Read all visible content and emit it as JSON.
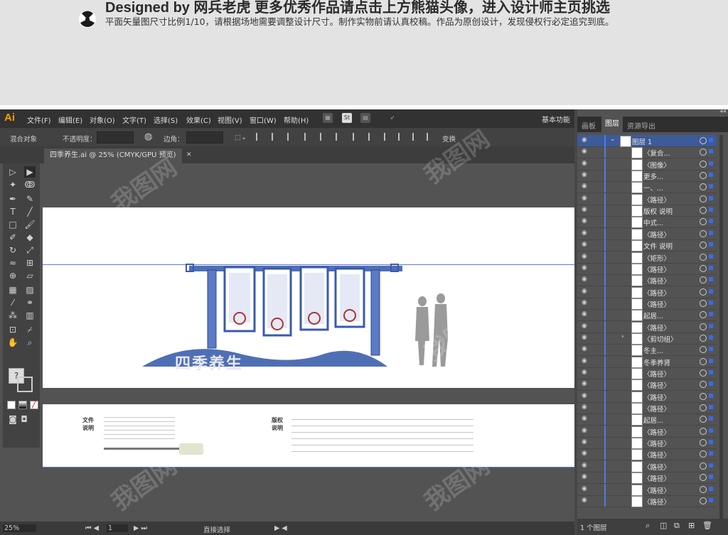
{
  "banner": {
    "title": "Designed by 网兵老虎        更多优秀作品请点击上方熊猫头像，进入设计师主页挑选",
    "subtitle": "平面矢量图尺寸比例1/10，请根据场地需要调整设计尺寸。制作实物前请认真校稿。作品为原创设计，发现侵权行必定追究到底。"
  },
  "app": {
    "logo": "Ai",
    "menu": [
      "文件(F)",
      "编辑(E)",
      "对象(O)",
      "文字(T)",
      "选择(S)",
      "效果(C)",
      "视图(V)",
      "窗口(W)",
      "帮助(H)"
    ],
    "workspace": "基本功能"
  },
  "control_bar": {
    "mode": "混合对象",
    "opacity_label": "不透明度：",
    "corner_label": "边角：",
    "transform_label": "变换"
  },
  "document_tab": {
    "title": "四季养生.ai @ 25% (CMYK/GPU 预览)"
  },
  "artwork": {
    "board_label_left": "文件\n说明",
    "board_label_right": "版权\n说明",
    "banner_text": "四季养生"
  },
  "status_bar": {
    "zoom": "25%",
    "page": "1",
    "tool": "直接选择"
  },
  "panel": {
    "tabs": [
      "画板",
      "图层",
      "资源导出"
    ],
    "active_tab": "图层",
    "layer_top": "图层 1",
    "rows": [
      "〈复合...",
      "〈图像〉",
      "更多...",
      "一、...",
      "〈路径〉",
      "版权 说明",
      "中式...",
      "〈路径〉",
      "文件 说明",
      "〈矩形〉",
      "〈路径〉",
      "〈路径〉",
      "〈路径〉",
      "〈路径〉",
      "起居...",
      "〈路径〉",
      "〈剪切组〉",
      "冬主...",
      "冬季养肾",
      "〈路径〉",
      "〈路径〉",
      "〈路径〉",
      "〈路径〉",
      "起居...",
      "〈路径〉",
      "〈路径〉",
      "〈路径〉",
      "〈路径〉",
      "〈路径〉",
      "〈路径〉",
      "〈路径〉"
    ],
    "footer": "1 个图层"
  },
  "colors": {
    "accent": "#4f7ce0",
    "orange_logo": "#ff9a00",
    "panel_bg": "#535353"
  }
}
